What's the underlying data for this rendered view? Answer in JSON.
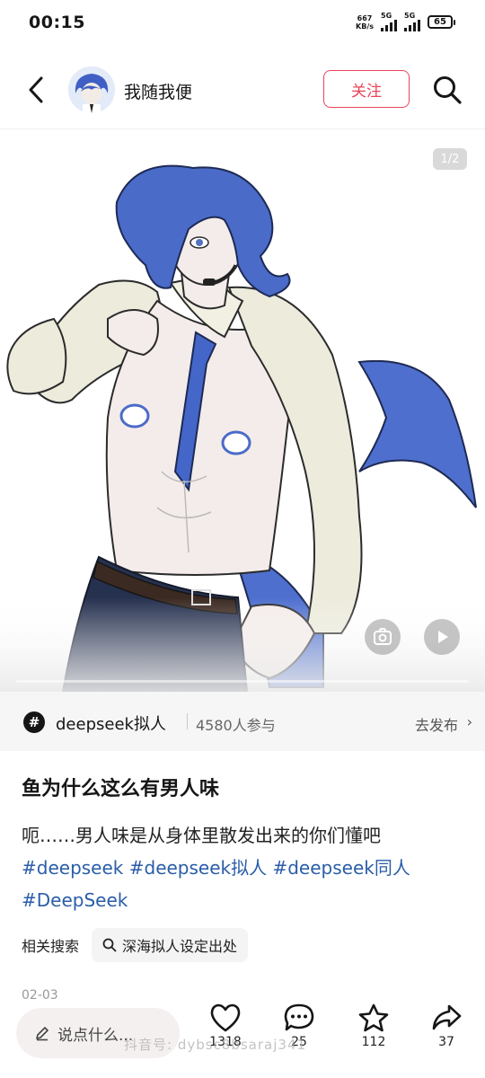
{
  "status_bar": {
    "time": "00:15",
    "net_speed_value": "667",
    "net_speed_unit": "KB/s",
    "sim1_label": "5G",
    "sim2_label": "5G",
    "battery": "65"
  },
  "header": {
    "username": "我随我便",
    "follow_label": "关注"
  },
  "media": {
    "page_indicator": "1/2"
  },
  "topic": {
    "icon_symbol": "#",
    "name": "deepseek拟人",
    "participants": "4580人参与",
    "post_label": "去发布",
    "chevron": "›"
  },
  "post": {
    "title": "鱼为什么这么有男人味",
    "body": "呃……男人味是从身体里散发出来的你们懂吧",
    "hashtags": [
      "#deepseek",
      "#deepseek拟人",
      "#deepseek同人",
      "#DeepSeek"
    ],
    "related_label": "相关搜索",
    "related_query": "深海拟人设定出处",
    "date": "02-03"
  },
  "bottom_bar": {
    "comment_placeholder": "说点什么...",
    "like_count": "1318",
    "comment_count": "25",
    "favorite_count": "112",
    "share_count": "37",
    "watermark": "抖音号: dybsc8bsaraj341"
  },
  "colors": {
    "accent": "#e8445a",
    "hashtag": "#2a5da8",
    "hair": "#4a6bc8"
  }
}
